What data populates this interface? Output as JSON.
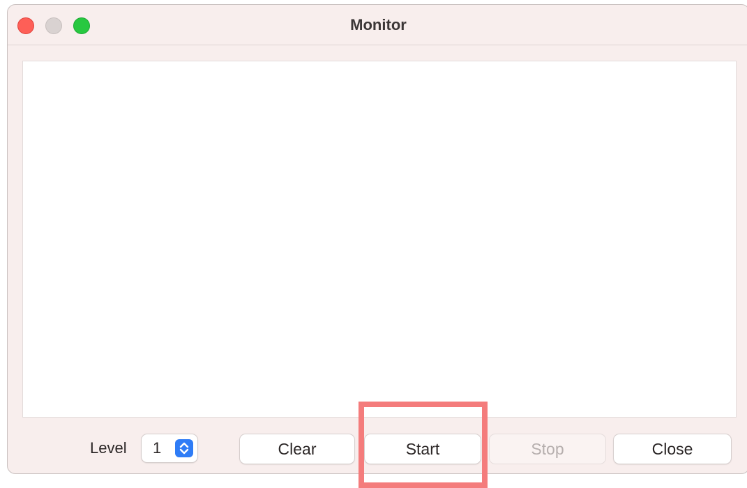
{
  "window": {
    "title": "Monitor"
  },
  "controls": {
    "level_label": "Level",
    "level_value": "1",
    "clear_label": "Clear",
    "start_label": "Start",
    "stop_label": "Stop",
    "close_label": "Close"
  },
  "colors": {
    "traffic_close": "#fe5f57",
    "traffic_minimize": "#d9d2d1",
    "traffic_zoom": "#28c840",
    "stepper_accent": "#2f7cf6",
    "highlight": "#f47c7c"
  },
  "icons": {
    "stepper": "up-down-chevron-icon"
  }
}
